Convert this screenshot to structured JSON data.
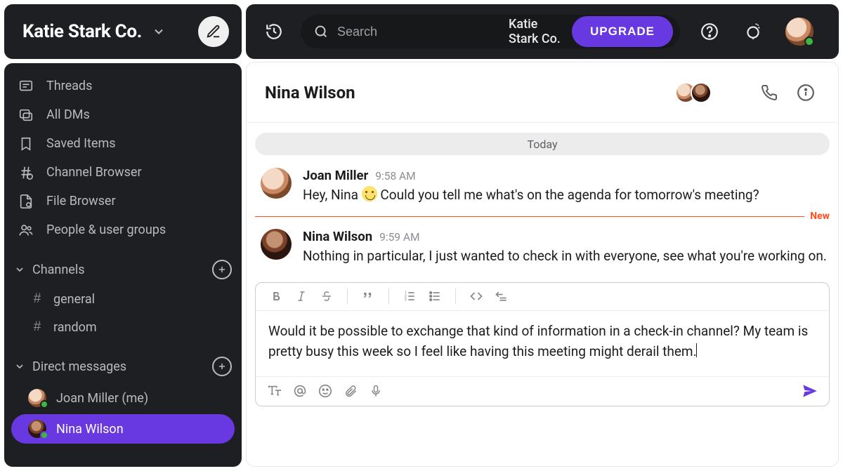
{
  "workspace": {
    "name": "Katie Stark Co."
  },
  "topbar": {
    "search_placeholder": "Search",
    "search_context": "Katie Stark Co.",
    "upgrade_label": "UPGRADE"
  },
  "sidebar": {
    "nav": [
      {
        "key": "threads",
        "label": "Threads"
      },
      {
        "key": "all-dms",
        "label": "All DMs"
      },
      {
        "key": "saved",
        "label": "Saved Items"
      },
      {
        "key": "channel-browser",
        "label": "Channel Browser"
      },
      {
        "key": "file-browser",
        "label": "File Browser"
      },
      {
        "key": "people",
        "label": "People & user groups"
      }
    ],
    "sections": {
      "channels": {
        "label": "Channels",
        "items": [
          "general",
          "random"
        ]
      },
      "dms": {
        "label": "Direct messages",
        "items": [
          {
            "name": "Joan Miller (me)",
            "active": false,
            "avatar": "me"
          },
          {
            "name": "Nina Wilson",
            "active": true,
            "avatar": "nina"
          }
        ]
      }
    }
  },
  "chat": {
    "title": "Nina Wilson",
    "date_label": "Today",
    "new_label": "New",
    "messages": [
      {
        "author": "Joan Miller",
        "time": "9:58 AM",
        "avatar": "me",
        "text_pre": "Hey, Nina ",
        "text_post": " Could you tell me what's on the agenda for tomorrow's meeting?",
        "has_emoji": true
      },
      {
        "author": "Nina Wilson",
        "time": "9:59 AM",
        "avatar": "nina",
        "text_pre": "Nothing in particular, I just wanted to check in with everyone, see what you're working on.",
        "text_post": "",
        "has_emoji": false
      }
    ]
  },
  "composer": {
    "draft": "Would it be possible to exchange that kind of information in a check-in channel? My team is pretty busy this week so I feel like having this meeting might derail them."
  }
}
